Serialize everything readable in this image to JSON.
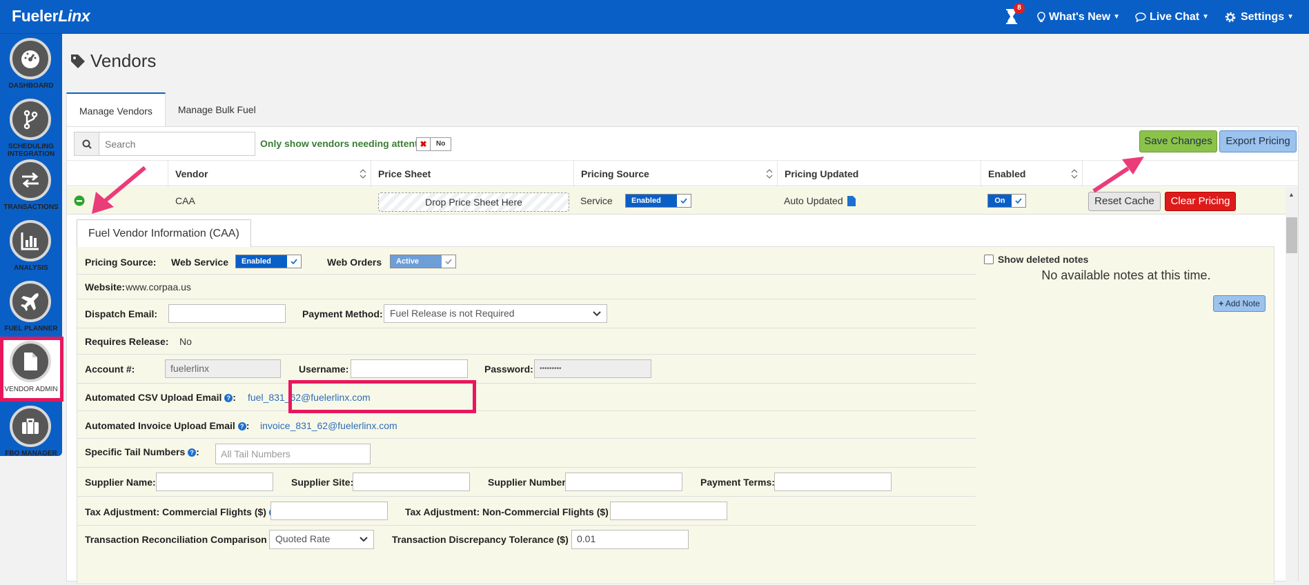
{
  "topbar": {
    "logo_a": "Fueler",
    "logo_b": "Linx",
    "notif_count": "8",
    "whats_new": "What's New",
    "live_chat": "Live Chat",
    "settings": "Settings"
  },
  "sidebar": {
    "items": [
      {
        "label": "DASHBOARD"
      },
      {
        "label": "SCHEDULING INTEGRATION"
      },
      {
        "label": "TRANSACTIONS"
      },
      {
        "label": "ANALYSIS"
      },
      {
        "label": "FUEL PLANNER"
      },
      {
        "label": "VENDOR ADMIN"
      },
      {
        "label": "FBO MANAGER"
      }
    ]
  },
  "page": {
    "title": "Vendors",
    "tabs": [
      "Manage Vendors",
      "Manage Bulk Fuel"
    ]
  },
  "toolbar": {
    "search_placeholder": "Search",
    "attention_label": "Only show vendors needing attention",
    "attention_toggle": "No",
    "save_label": "Save Changes",
    "export_label": "Export Pricing"
  },
  "table": {
    "headers": [
      "Vendor",
      "Price Sheet",
      "Pricing Source",
      "Pricing Updated",
      "Enabled"
    ],
    "row": {
      "vendor": "CAA",
      "price_sheet": "Drop Price Sheet Here",
      "pricing_source": "Service",
      "source_state": "Enabled",
      "pricing_updated": "Auto Updated",
      "enabled_state": "On",
      "reset_label": "Reset Cache",
      "clear_label": "Clear Pricing"
    }
  },
  "detail": {
    "tab": "Fuel Vendor Information (CAA)",
    "pricing_source_label": "Pricing Source:",
    "web_service_label": "Web Service",
    "web_service_state": "Enabled",
    "web_orders_label": "Web Orders",
    "web_orders_state": "Active",
    "website_label": "Website:",
    "website_value": "www.corpaa.us",
    "dispatch_label": "Dispatch Email:",
    "payment_label": "Payment Method:",
    "payment_value": "Fuel Release is not Required",
    "requires_label": "Requires Release:",
    "requires_value": "No",
    "account_label": "Account #:",
    "account_value": "fuelerlinx",
    "username_label": "Username:",
    "password_label": "Password:",
    "password_value": "•••••••••",
    "csv_label": "Automated CSV Upload Email",
    "csv_value": "fuel_831_62@fuelerlinx.com",
    "invoice_label": "Automated Invoice Upload Email",
    "invoice_value": "invoice_831_62@fuelerlinx.com",
    "tail_label": "Specific Tail Numbers",
    "tail_placeholder": "All Tail Numbers",
    "supplier_name_label": "Supplier Name:",
    "supplier_site_label": "Supplier Site:",
    "supplier_number_label": "Supplier Number:",
    "payment_terms_label": "Payment Terms:",
    "tax_comm_label": "Tax Adjustment: Commercial Flights ($)",
    "tax_noncomm_label": "Tax Adjustment: Non-Commercial Flights ($)",
    "recon_label": "Transaction Reconciliation Comparison",
    "recon_value": "Quoted Rate",
    "tolerance_label": "Transaction Discrepancy Tolerance ($)",
    "tolerance_value": "0.01",
    "colon": ":"
  },
  "notes": {
    "show_deleted": "Show deleted notes",
    "empty": "No available notes at this time.",
    "add_note": "Add Note"
  },
  "colors": {
    "brand_blue": "#0a5fc6",
    "highlight": "#e8175d",
    "save_green": "#8bc34a",
    "clear_red": "#dd1b1b"
  }
}
